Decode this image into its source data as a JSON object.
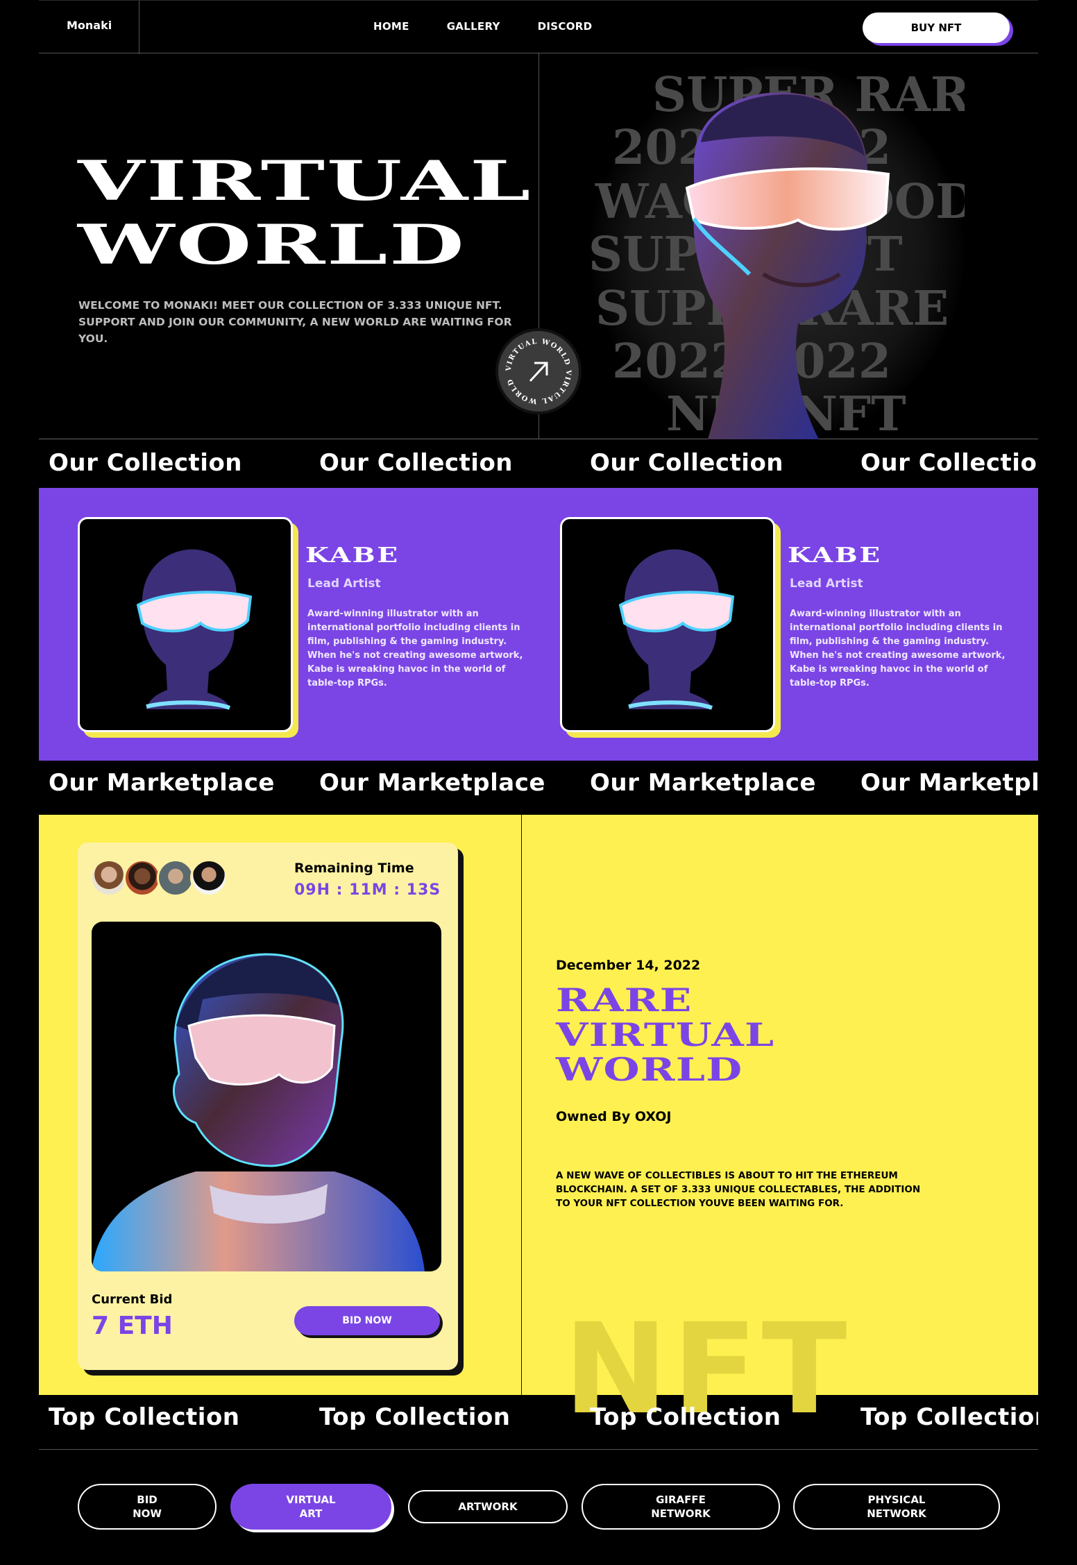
{
  "nav": {
    "logo": "Monaki",
    "links": [
      "HOME",
      "GALLERY",
      "DISCORD"
    ],
    "buy_label": "BUY NFT"
  },
  "hero": {
    "title_line1": "VIRTUAL",
    "title_line2": "WORLD",
    "subtitle": "WELCOME TO Monaki! MEET OUR COLLECTION OF 3.333 UNIQUE NFT. SUPPORT AND JOIN OUR COMMUNITY, A NEW WORLD ARE WAITING FOR YOU.",
    "badge_text": "VIRTUAL WORLD VIRTUAL WORLD",
    "badge_icon": "arrow-up-right-icon",
    "bg_words": [
      "SUPER RARE",
      "2022 2022",
      "WAGMI GOOD",
      "SUPER NFT",
      "SUPER RARE",
      "2022 2022",
      "NFT NFT"
    ]
  },
  "collection": {
    "marquee_label": "Our Collection",
    "artists": [
      {
        "name": "KABE",
        "role": "Lead Artist",
        "bio": "Award-winning illustrator with an international portfolio including clients in film, publishing & the gaming industry. When he's not creating awesome artwork, Kabe is wreaking havoc in the world of table-top RPGs."
      },
      {
        "name": "KABE",
        "role": "Lead Artist",
        "bio": "Award-winning illustrator with an international portfolio including clients in film, publishing & the gaming industry. When he's not creating awesome artwork, Kabe is wreaking havoc in the world of table-top RPGs."
      }
    ]
  },
  "marketplace": {
    "marquee_label": "Our Marketplace",
    "remaining_label": "Remaining Time",
    "remaining_time": "09H : 11M : 13S",
    "current_bid_label": "Current Bid",
    "current_bid_value": "7 ETH",
    "bid_button": "BID NOW",
    "date": "December 14, 2022",
    "title_lines": [
      "RARE",
      "VIRTUAL",
      "WORLD"
    ],
    "owner": "Owned By OXOJ",
    "description": "A NEW WAVE OF COLLECTIBLES IS ABOUT TO HIT THE ETHEREUM BLOCKCHAIN. A SET OF 3.333 UNIQUE COLLECTABLES, THE ADDITION TO YOUR NFT COLLECTION YOUVE BEEN WAITING FOR.",
    "bg_word": "NFT"
  },
  "top": {
    "marquee_label": "Top Collection",
    "filters": [
      {
        "line1": "BID",
        "line2": "NOW"
      },
      {
        "line1": "VIRTUAL",
        "line2": "ART"
      },
      {
        "line1": "ARTWORK",
        "line2": ""
      },
      {
        "line1": "GIRAFFE",
        "line2": "NETWORK"
      },
      {
        "line1": "PHYSICAL",
        "line2": "NETWORK"
      }
    ],
    "active_filter": "VIRTUAL ART"
  },
  "colors": {
    "purple": "#7b45e5",
    "yellow": "#fdf050",
    "black": "#000000"
  }
}
